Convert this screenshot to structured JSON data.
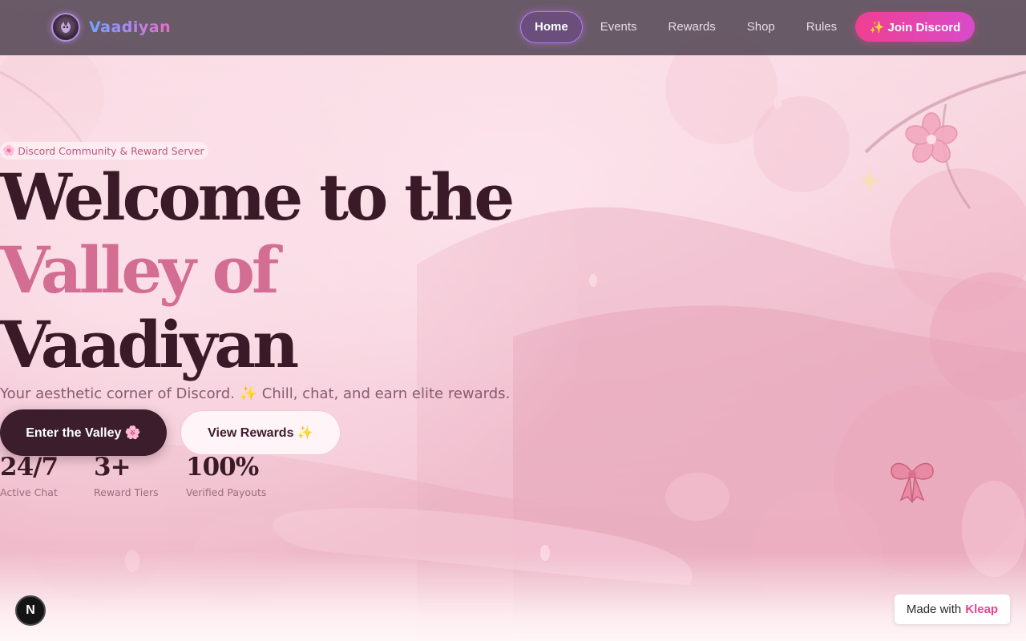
{
  "nav": {
    "brand": "Vaadiyan",
    "links": [
      {
        "label": "Home"
      },
      {
        "label": "Events"
      },
      {
        "label": "Rewards"
      },
      {
        "label": "Shop"
      },
      {
        "label": "Rules"
      }
    ],
    "cta": "✨ Join Discord"
  },
  "hero": {
    "tag": "Discord Community & Reward Server",
    "headline_line1": "Welcome to the",
    "headline_line2": "Valley of",
    "headline_line3": "Vaadiyan",
    "subtitle": "Your aesthetic corner of Discord. ✨ Chill, chat, and earn elite rewards.",
    "primary_button": "Enter the Valley 🌸",
    "secondary_button": "View Rewards ✨",
    "stats": [
      {
        "value": "24/7",
        "label": "Active Chat"
      },
      {
        "value": "3+",
        "label": "Reward Tiers"
      },
      {
        "value": "100%",
        "label": "Verified Payouts"
      }
    ]
  },
  "footer_badges": {
    "next_logo": "N",
    "made_with_prefix": "Made with",
    "made_with_brand": "Kleap"
  },
  "colors": {
    "accent_pink": "#d46d92",
    "dark_plum": "#3a1a27",
    "cta_gradient_start": "#f03f92",
    "cta_gradient_end": "#d84bc9"
  },
  "icons": [
    "flower-icon",
    "sparkle-icon",
    "bow-icon",
    "next-logo-icon"
  ]
}
